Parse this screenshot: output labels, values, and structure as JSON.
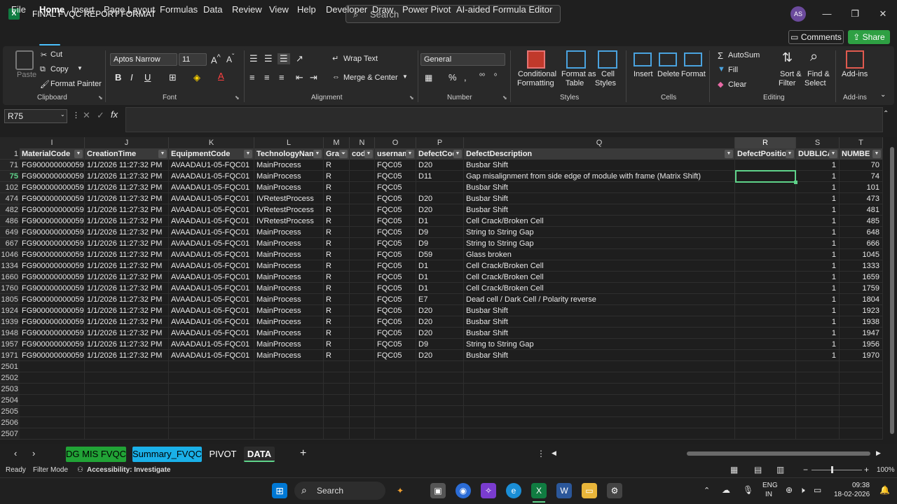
{
  "titlebar": {
    "doc_title": "FINAL FVQC REPORT FORMAT",
    "search_placeholder": "Search",
    "avatar_initials": "AS"
  },
  "menu": [
    "File",
    "Home",
    "Insert",
    "Page Layout",
    "Formulas",
    "Data",
    "Review",
    "View",
    "Help",
    "Developer",
    "Draw",
    "Power Pivot",
    "AI-aided Formula Editor"
  ],
  "menu_actions": {
    "comments": "Comments",
    "share": "Share"
  },
  "ribbon": {
    "clipboard": {
      "paste": "Paste",
      "cut": "Cut",
      "copy": "Copy",
      "format_painter": "Format Painter",
      "group": "Clipboard"
    },
    "font": {
      "name": "Aptos Narrow",
      "size": "11",
      "group": "Font"
    },
    "alignment": {
      "wrap": "Wrap Text",
      "merge": "Merge & Center",
      "group": "Alignment"
    },
    "number": {
      "format": "General",
      "group": "Number"
    },
    "styles": {
      "cond1": "Conditional",
      "cond2": "Formatting",
      "table1": "Format as",
      "table2": "Table",
      "cell1": "Cell",
      "cell2": "Styles",
      "group": "Styles"
    },
    "cells": {
      "insert": "Insert",
      "delete": "Delete",
      "format": "Format",
      "group": "Cells"
    },
    "editing": {
      "autosum": "AutoSum",
      "fill": "Fill",
      "clear": "Clear",
      "sort1": "Sort &",
      "sort2": "Filter",
      "find1": "Find &",
      "find2": "Select",
      "group": "Editing"
    },
    "addins": {
      "label": "Add-ins",
      "group": "Add-ins"
    }
  },
  "formula_bar": {
    "name_box": "R75",
    "value": ""
  },
  "columns": [
    "I",
    "J",
    "K",
    "L",
    "M",
    "N",
    "O",
    "P",
    "Q",
    "R",
    "S",
    "T"
  ],
  "headers": [
    "MaterialCode",
    "CreationTime",
    "EquipmentCode",
    "TechnologyNam",
    "Grac",
    "cod",
    "usernam",
    "DefectCod",
    "DefectDescription",
    "DefectPositio",
    "DUBLICA",
    "NUMBE"
  ],
  "rows": [
    {
      "r": "71",
      "c": [
        "FG900000000059",
        "1/1/2026 11:27:32 PM",
        "AVAADAU1-05-FQC01",
        "MainProcess",
        "R",
        "",
        "FQC05",
        "D20",
        "Busbar Shift",
        "",
        "1",
        "70"
      ]
    },
    {
      "r": "75",
      "c": [
        "FG900000000059",
        "1/1/2026 11:27:32 PM",
        "AVAADAU1-05-FQC01",
        "MainProcess",
        "R",
        "",
        "FQC05",
        "D11",
        "Gap misalignment from side edge of module with frame (Matrix Shift)",
        "",
        "1",
        "74"
      ]
    },
    {
      "r": "102",
      "c": [
        "FG900000000059",
        "1/1/2026 11:27:32 PM",
        "AVAADAU1-05-FQC01",
        "MainProcess",
        "R",
        "",
        "FQC05",
        "",
        "Busbar Shift",
        "",
        "1",
        "101"
      ]
    },
    {
      "r": "474",
      "c": [
        "FG900000000059",
        "1/1/2026 11:27:32 PM",
        "AVAADAU1-05-FQC01",
        "IVRetestProcess",
        "R",
        "",
        "FQC05",
        "D20",
        "Busbar Shift",
        "",
        "1",
        "473"
      ]
    },
    {
      "r": "482",
      "c": [
        "FG900000000059",
        "1/1/2026 11:27:32 PM",
        "AVAADAU1-05-FQC01",
        "IVRetestProcess",
        "R",
        "",
        "FQC05",
        "D20",
        "Busbar Shift",
        "",
        "1",
        "481"
      ]
    },
    {
      "r": "486",
      "c": [
        "FG900000000059",
        "1/1/2026 11:27:32 PM",
        "AVAADAU1-05-FQC01",
        "IVRetestProcess",
        "R",
        "",
        "FQC05",
        "D1",
        "Cell Crack/Broken Cell",
        "",
        "1",
        "485"
      ]
    },
    {
      "r": "649",
      "c": [
        "FG900000000059",
        "1/1/2026 11:27:32 PM",
        "AVAADAU1-05-FQC01",
        "MainProcess",
        "R",
        "",
        "FQC05",
        "D9",
        "String to String Gap",
        "",
        "1",
        "648"
      ]
    },
    {
      "r": "667",
      "c": [
        "FG900000000059",
        "1/1/2026 11:27:32 PM",
        "AVAADAU1-05-FQC01",
        "MainProcess",
        "R",
        "",
        "FQC05",
        "D9",
        "String to String Gap",
        "",
        "1",
        "666"
      ]
    },
    {
      "r": "1046",
      "c": [
        "FG900000000059",
        "1/1/2026 11:27:32 PM",
        "AVAADAU1-05-FQC01",
        "MainProcess",
        "R",
        "",
        "FQC05",
        "D59",
        "Glass broken",
        "",
        "1",
        "1045"
      ]
    },
    {
      "r": "1334",
      "c": [
        "FG900000000059",
        "1/1/2026 11:27:32 PM",
        "AVAADAU1-05-FQC01",
        "MainProcess",
        "R",
        "",
        "FQC05",
        "D1",
        "Cell Crack/Broken Cell",
        "",
        "1",
        "1333"
      ]
    },
    {
      "r": "1660",
      "c": [
        "FG900000000059",
        "1/1/2026 11:27:32 PM",
        "AVAADAU1-05-FQC01",
        "MainProcess",
        "R",
        "",
        "FQC05",
        "D1",
        "Cell Crack/Broken Cell",
        "",
        "1",
        "1659"
      ]
    },
    {
      "r": "1760",
      "c": [
        "FG900000000059",
        "1/1/2026 11:27:32 PM",
        "AVAADAU1-05-FQC01",
        "MainProcess",
        "R",
        "",
        "FQC05",
        "D1",
        "Cell Crack/Broken Cell",
        "",
        "1",
        "1759"
      ]
    },
    {
      "r": "1805",
      "c": [
        "FG900000000059",
        "1/1/2026 11:27:32 PM",
        "AVAADAU1-05-FQC01",
        "MainProcess",
        "R",
        "",
        "FQC05",
        "E7",
        "Dead cell / Dark Cell / Polarity reverse",
        "",
        "1",
        "1804"
      ]
    },
    {
      "r": "1924",
      "c": [
        "FG900000000059",
        "1/1/2026 11:27:32 PM",
        "AVAADAU1-05-FQC01",
        "MainProcess",
        "R",
        "",
        "FQC05",
        "D20",
        "Busbar Shift",
        "",
        "1",
        "1923"
      ]
    },
    {
      "r": "1939",
      "c": [
        "FG900000000059",
        "1/1/2026 11:27:32 PM",
        "AVAADAU1-05-FQC01",
        "MainProcess",
        "R",
        "",
        "FQC05",
        "D20",
        "Busbar Shift",
        "",
        "1",
        "1938"
      ]
    },
    {
      "r": "1948",
      "c": [
        "FG900000000059",
        "1/1/2026 11:27:32 PM",
        "AVAADAU1-05-FQC01",
        "MainProcess",
        "R",
        "",
        "FQC05",
        "D20",
        "Busbar Shift",
        "",
        "1",
        "1947"
      ]
    },
    {
      "r": "1957",
      "c": [
        "FG900000000059",
        "1/1/2026 11:27:32 PM",
        "AVAADAU1-05-FQC01",
        "MainProcess",
        "R",
        "",
        "FQC05",
        "D9",
        "String to String Gap",
        "",
        "1",
        "1956"
      ]
    },
    {
      "r": "1971",
      "c": [
        "FG900000000059",
        "1/1/2026 11:27:32 PM",
        "AVAADAU1-05-FQC01",
        "MainProcess",
        "R",
        "",
        "FQC05",
        "D20",
        "Busbar Shift",
        "",
        "1",
        "1970"
      ]
    }
  ],
  "empty_rows": [
    "2501",
    "2502",
    "2503",
    "2504",
    "2505",
    "2506",
    "2507"
  ],
  "sheets": [
    {
      "name": "DG MIS FVQC",
      "bg": "#21a336",
      "fg": "#000000"
    },
    {
      "name": "Summary_FVQC",
      "bg": "#1ab0e8",
      "fg": "#000000"
    },
    {
      "name": "PIVOT",
      "bg": "#1f1f1f",
      "fg": "#ffffff"
    },
    {
      "name": "DATA",
      "bg": "#2b2b2b",
      "fg": "#ffffff"
    }
  ],
  "status": {
    "ready": "Ready",
    "filter": "Filter Mode",
    "accessibility": "Accessibility: Investigate",
    "zoom": "100%"
  },
  "taskbar": {
    "search": "Search",
    "lang1": "ENG",
    "lang2": "IN",
    "time": "09:38",
    "date": "18-02-2026"
  },
  "colors": {
    "accent_green": "#5fd38a",
    "excel_green": "#107c41",
    "share_green": "#2ea043",
    "tab_underline": "#4cc2ff"
  }
}
